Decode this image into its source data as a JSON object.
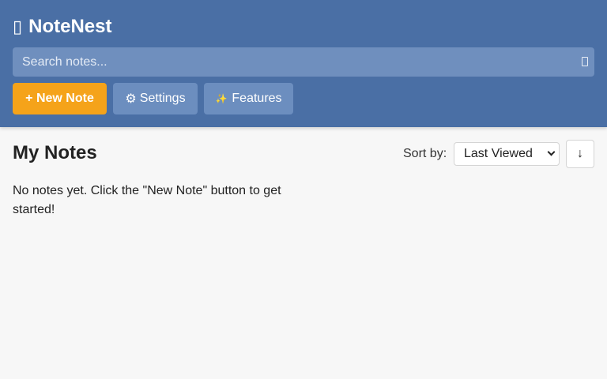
{
  "app": {
    "name": "NoteNest"
  },
  "search": {
    "placeholder": "Search notes...",
    "value": ""
  },
  "toolbar": {
    "new_note_label": "+ New Note",
    "settings_icon": "⚙",
    "settings_label": "Settings",
    "features_icon": "✨",
    "features_label": "Features"
  },
  "main": {
    "title": "My Notes",
    "sort_label": "Sort by:",
    "sort_selected": "Last Viewed",
    "sort_direction": "↓",
    "empty_message": "No notes yet. Click the \"New Note\" button to get started!"
  },
  "colors": {
    "header_bg": "#4a6fa5",
    "primary_accent": "#f5a31a",
    "secondary_button": "#6c8ebf"
  }
}
